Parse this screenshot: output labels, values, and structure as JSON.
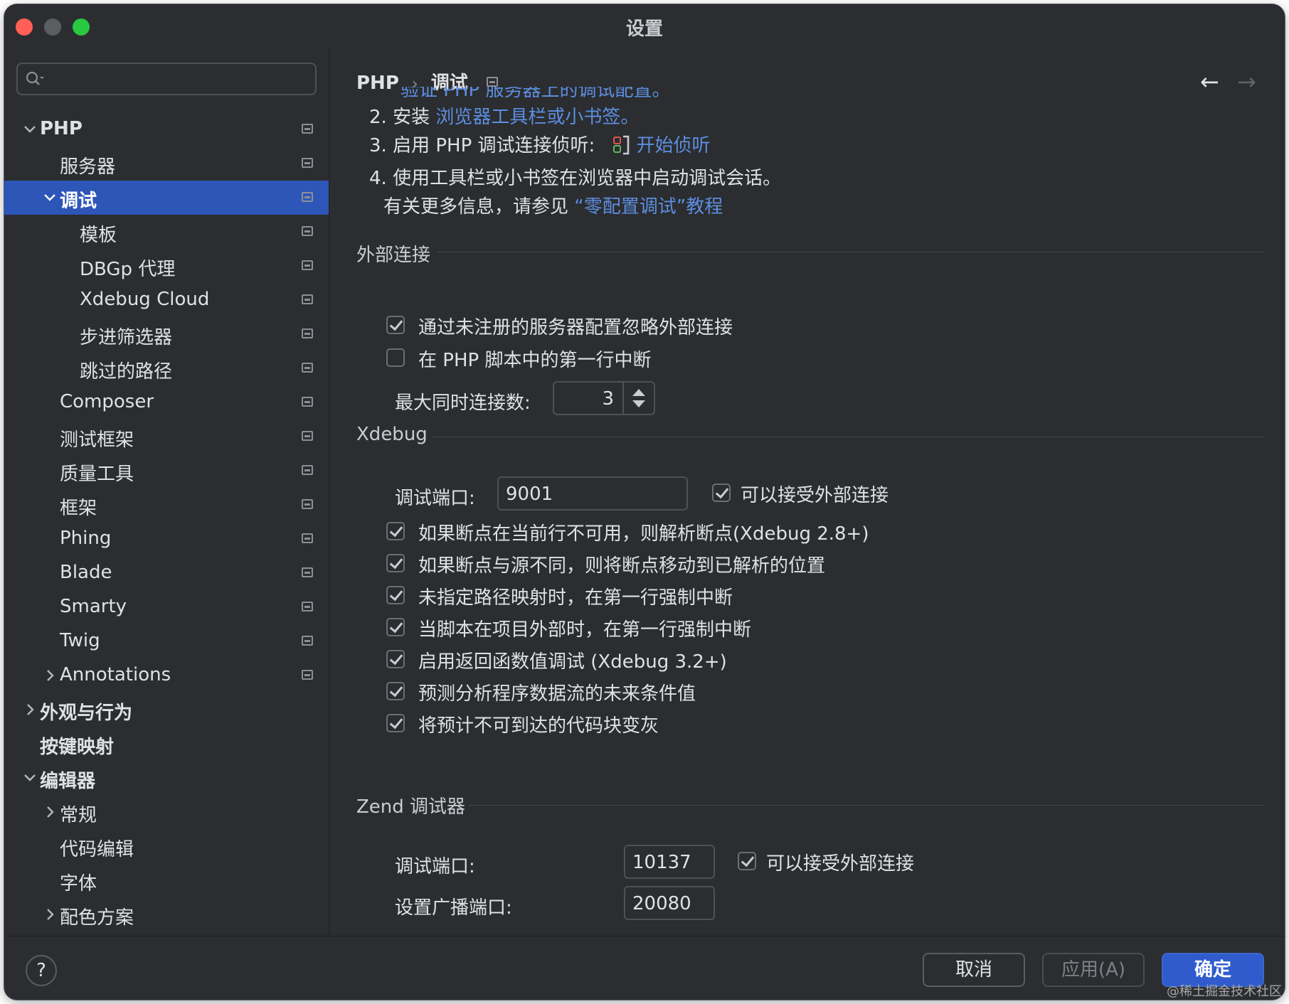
{
  "window": {
    "title": "设置"
  },
  "sidebar": {
    "search_placeholder": "",
    "items": [
      {
        "label": "PHP",
        "bold": true,
        "chevron": "down",
        "indent": 0,
        "pin": true
      },
      {
        "label": "服务器",
        "indent": 1,
        "pin": true
      },
      {
        "label": "调试",
        "bold": true,
        "chevron": "down",
        "indent": 1,
        "selected": true,
        "pin": true
      },
      {
        "label": "模板",
        "indent": 2,
        "pin": true
      },
      {
        "label": "DBGp 代理",
        "indent": 2,
        "pin": true
      },
      {
        "label": "Xdebug Cloud",
        "indent": 2,
        "pin": true
      },
      {
        "label": "步进筛选器",
        "indent": 2,
        "pin": true
      },
      {
        "label": "跳过的路径",
        "indent": 2,
        "pin": true
      },
      {
        "label": "Composer",
        "indent": 1,
        "pin": true
      },
      {
        "label": "测试框架",
        "indent": 1,
        "pin": true
      },
      {
        "label": "质量工具",
        "indent": 1,
        "pin": true
      },
      {
        "label": "框架",
        "indent": 1,
        "pin": true
      },
      {
        "label": "Phing",
        "indent": 1,
        "pin": true
      },
      {
        "label": "Blade",
        "indent": 1,
        "pin": true
      },
      {
        "label": "Smarty",
        "indent": 1,
        "pin": true
      },
      {
        "label": "Twig",
        "indent": 1,
        "pin": true
      },
      {
        "label": "Annotations",
        "chevron": "right",
        "indent": 1,
        "pin": true
      },
      {
        "label": "外观与行为",
        "bold": true,
        "chevron": "right",
        "indent": 0
      },
      {
        "label": "按键映射",
        "bold": true,
        "indent": 0
      },
      {
        "label": "编辑器",
        "bold": true,
        "chevron": "down",
        "indent": 0
      },
      {
        "label": "常规",
        "chevron": "right",
        "indent": 1
      },
      {
        "label": "代码编辑",
        "indent": 1
      },
      {
        "label": "字体",
        "indent": 1
      },
      {
        "label": "配色方案",
        "chevron": "right",
        "indent": 1
      }
    ]
  },
  "breadcrumb": {
    "root": "PHP",
    "separator": "›",
    "current": "调试"
  },
  "instructions": {
    "clipped_text": "验证 PHP 服务器上的调试配置。",
    "step2_prefix": "2. 安装 ",
    "step2_link": "浏览器工具栏或小书签。",
    "step3_prefix": "3. 启用 PHP 调试连接侦听:",
    "step3_link": "开始侦听",
    "step4": "4. 使用工具栏或小书签在浏览器中启动调试会话。",
    "more_prefix": "有关更多信息，请参见 ",
    "more_link": "“零配置调试”教程"
  },
  "external": {
    "title": "外部连接",
    "ignore_label": "通过未注册的服务器配置忽略外部连接",
    "ignore_checked": true,
    "break_first_label": "在 PHP 脚本中的第一行中断",
    "break_first_checked": false,
    "max_conn_label": "最大同时连接数:",
    "max_conn_value": "3"
  },
  "xdebug": {
    "title": "Xdebug",
    "port_label": "调试端口:",
    "port_value": "9001",
    "accept_label": "可以接受外部连接",
    "accept_checked": true,
    "options": [
      {
        "label": "如果断点在当前行不可用，则解析断点(Xdebug 2.8+)",
        "checked": true
      },
      {
        "label": "如果断点与源不同，则将断点移动到已解析的位置",
        "checked": true
      },
      {
        "label": "未指定路径映射时，在第一行强制中断",
        "checked": true
      },
      {
        "label": "当脚本在项目外部时，在第一行强制中断",
        "checked": true
      },
      {
        "label": "启用返回函数值调试 (Xdebug 3.2+)",
        "checked": true
      },
      {
        "label": "预测分析程序数据流的未来条件值",
        "checked": true
      },
      {
        "label": "将预计不可到达的代码块变灰",
        "checked": true
      }
    ]
  },
  "zend": {
    "title": "Zend 调试器",
    "port_label": "调试端口:",
    "port_value": "10137",
    "accept_label": "可以接受外部连接",
    "accept_checked": true,
    "broadcast_label": "设置广播端口:",
    "broadcast_value": "20080"
  },
  "footer": {
    "help": "?",
    "cancel": "取消",
    "apply": "应用(A)",
    "ok": "确定"
  },
  "watermark": "@稀土掘金技术社区",
  "colors": {
    "accent": "#2e55b8",
    "link": "#5c8ee0",
    "bg": "#2b2d30"
  }
}
